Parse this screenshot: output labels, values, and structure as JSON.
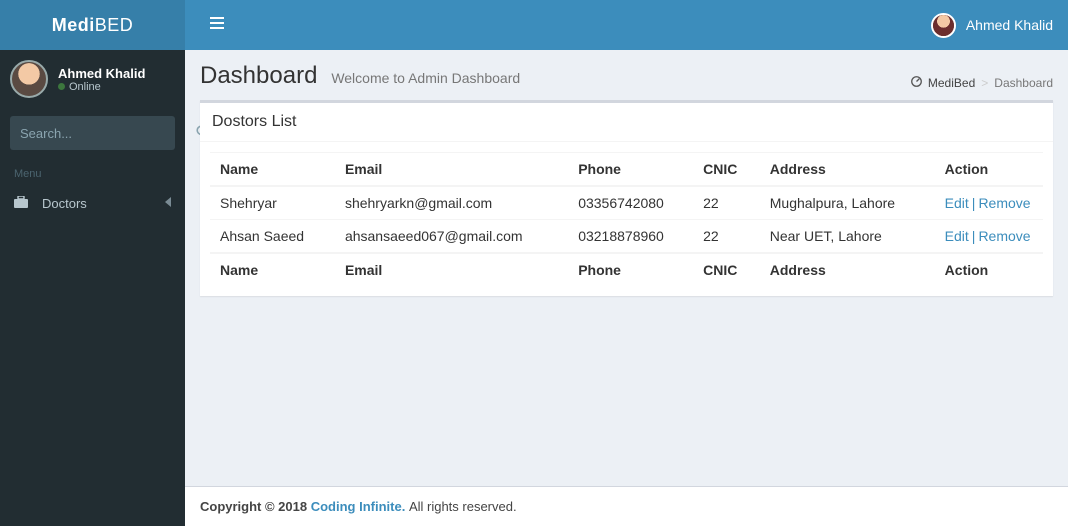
{
  "brand": {
    "prefix": "Medi",
    "suffix": "BED"
  },
  "top_user": {
    "name": "Ahmed Khalid"
  },
  "sidebar_user": {
    "name": "Ahmed Khalid",
    "status": "Online"
  },
  "search": {
    "placeholder": "Search..."
  },
  "menu": {
    "header": "Menu"
  },
  "nav": {
    "doctors": "Doctors"
  },
  "header": {
    "title": "Dashboard",
    "subtitle": "Welcome to Admin Dashboard"
  },
  "breadcrumb": {
    "home": "MediBed",
    "current": "Dashboard"
  },
  "box": {
    "title": "Dostors List"
  },
  "columns": {
    "name": "Name",
    "email": "Email",
    "phone": "Phone",
    "cnic": "CNIC",
    "address": "Address",
    "action": "Action"
  },
  "action_labels": {
    "edit": "Edit",
    "remove": "Remove"
  },
  "rows": [
    {
      "name": "Shehryar",
      "email": "shehryarkn@gmail.com",
      "phone": "03356742080",
      "cnic": "22",
      "address": "Mughalpura, Lahore"
    },
    {
      "name": "Ahsan Saeed",
      "email": "ahsansaeed067@gmail.com",
      "phone": "03218878960",
      "cnic": "22",
      "address": "Near UET, Lahore"
    }
  ],
  "footer": {
    "prefix": "Copyright © 2018 ",
    "link": "Coding Infinite.",
    "suffix": " All rights reserved."
  }
}
